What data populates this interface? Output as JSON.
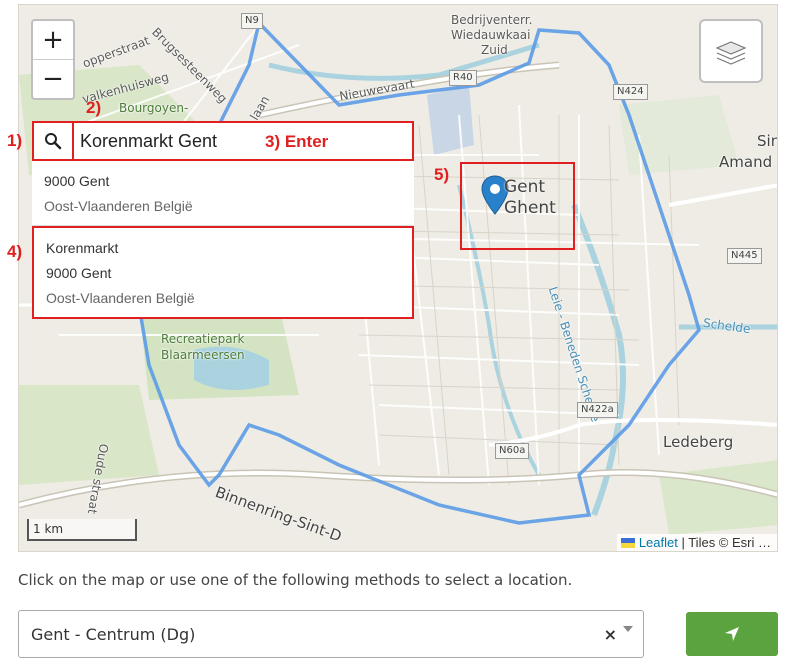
{
  "map": {
    "zoom_in": "+",
    "zoom_out": "−",
    "labels": {
      "n9": "N9",
      "bedrijf1": "Bedrijventerr.",
      "bedrijf2": "Wiedauwkaai",
      "bedrijf3": "Zuid",
      "r40": "R40",
      "nieuwevaart": "Nieuwevaart",
      "n424": "N424",
      "sint1": "Sin",
      "sint2": "Amand",
      "n445": "N445",
      "schelde": "Schelde",
      "benedenschelde": "Leie - Beneden Schelde",
      "recreatie1": "Recreatiepark",
      "recreatie2": "Blaarmeersen",
      "n422a": "N422a",
      "n60a": "N60a",
      "ledeberg": "Ledeberg",
      "binnenring": "Binnenring-Sint-D",
      "bourgoyen": "Bourgoyen-",
      "brugse": "Brugsesteenweg",
      "opperstraat": "opperstraat",
      "valkenhuisweg": "valkenhuisweg",
      "laan": "laan",
      "oudestraat": "Oude straat"
    },
    "scale_label": "1 km",
    "attribution": {
      "leaflet": "Leaflet",
      "rest": " | Tiles © Esri …"
    },
    "marker_name_line1": "Gent",
    "marker_name_line2": "Ghent"
  },
  "search": {
    "value": "Korenmarkt Gent",
    "icon": "search-icon"
  },
  "results": [
    {
      "line1": "9000 Gent",
      "line2": "Oost-Vlaanderen België"
    },
    {
      "line1": "Korenmarkt",
      "line2": "9000 Gent",
      "line3": "Oost-Vlaanderen België"
    }
  ],
  "annotations": {
    "a1": "1)",
    "a2": "2)",
    "a3": "3)  Enter",
    "a4": "4)",
    "a5": "5)"
  },
  "instructions": "Click on the map or use one of the following methods to select a location.",
  "location_select": {
    "value": "Gent - Centrum (Dg)",
    "clear": "×"
  },
  "colors": {
    "annotation_red": "#e02020",
    "boundary_blue": "#5b9be6",
    "button_green": "#5ba33e",
    "marker_blue": "#2a81cb"
  }
}
